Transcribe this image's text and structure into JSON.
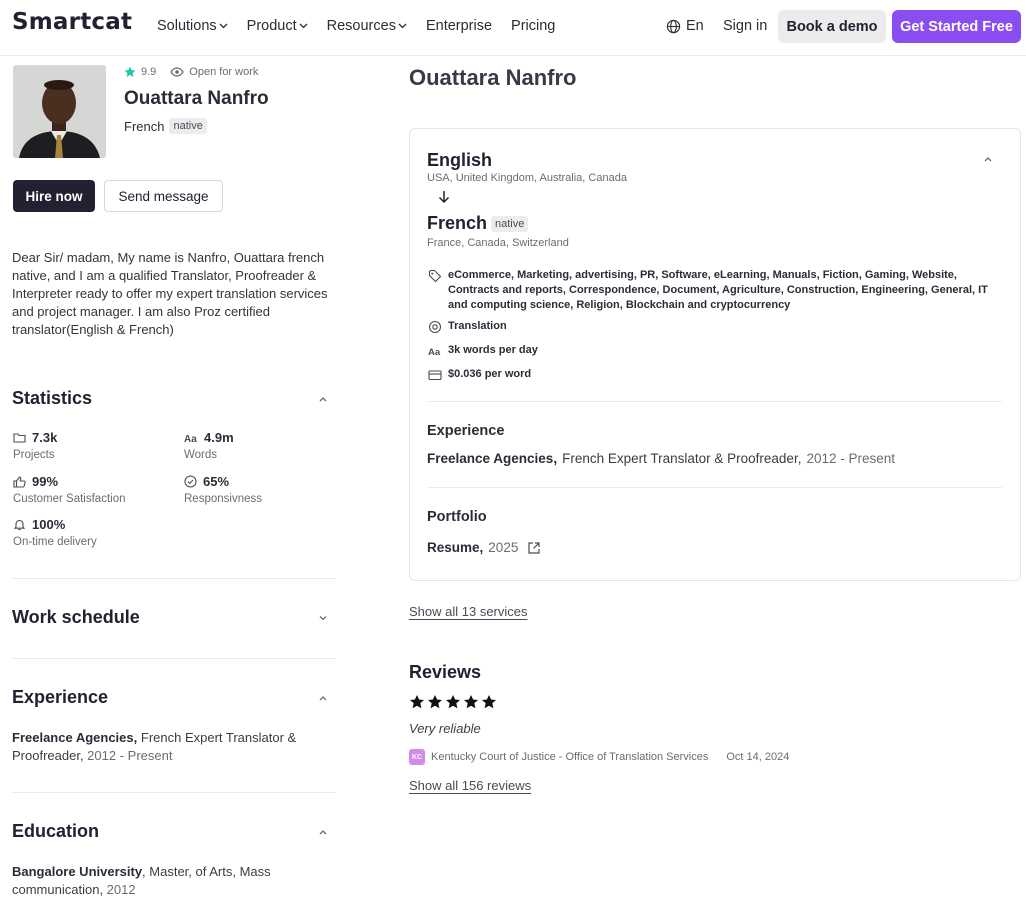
{
  "header": {
    "logo": "Smartcat",
    "nav": [
      "Solutions",
      "Product",
      "Resources",
      "Enterprise",
      "Pricing"
    ],
    "lang": "En",
    "signin": "Sign in",
    "demo": "Book a demo",
    "start": "Get Started Free"
  },
  "profile": {
    "rating": "9.9",
    "status": "Open for work",
    "name": "Ouattara Nanfro",
    "native_lang": "French",
    "native_badge": "native",
    "hire": "Hire now",
    "message": "Send message",
    "bio": "Dear Sir/ madam, My name is Nanfro, Ouattara french native, and I am a qualified Translator, Proofreader & Interpreter ready to offer my expert translation services and project manager. I am also Proz certified translator(English & French)"
  },
  "statistics": {
    "title": "Statistics",
    "items": [
      {
        "value": "7.3k",
        "label": "Projects",
        "icon": "folder-icon"
      },
      {
        "value": "4.9m",
        "label": "Words",
        "icon": "text-size-icon"
      },
      {
        "value": "99%",
        "label": "Customer Satisfaction",
        "icon": "thumbs-up-icon"
      },
      {
        "value": "65%",
        "label": "Responsivness",
        "icon": "check-circle-icon"
      },
      {
        "value": "100%",
        "label": "On-time delivery",
        "icon": "bell-icon"
      }
    ]
  },
  "work_schedule": {
    "title": "Work schedule"
  },
  "experience_left": {
    "title": "Experience",
    "company": "Freelance Agencies",
    "role": "French Expert Translator & Proofreader",
    "period": "2012 - Present"
  },
  "education": {
    "title": "Education",
    "school": "Bangalore University",
    "degree": "Master, of Arts, Mass communication",
    "year": "2012"
  },
  "service": {
    "source_lang": "English",
    "source_countries": "USA, United Kingdom, Australia, Canada",
    "target_lang": "French",
    "target_badge": "native",
    "target_countries": "France, Canada, Switzerland",
    "specializations": "eCommerce, Marketing, advertising, PR, Software, eLearning, Manuals, Fiction, Gaming, Website, Contracts and reports, Correspondence, Document, Agriculture, Construction, Engineering, General, IT and computing science, Religion, Blockchain and cryptocurrency",
    "service_type": "Translation",
    "capacity": "3k words per day",
    "rate": "$0.036 per word",
    "experience_title": "Experience",
    "exp_company": "Freelance Agencies",
    "exp_role": "French Expert Translator & Proofreader",
    "exp_period": "2012 - Present",
    "portfolio_title": "Portfolio",
    "portfolio_item": "Resume",
    "portfolio_year": "2025"
  },
  "show_services": "Show all 13 services",
  "reviews": {
    "title": "Reviews",
    "stars": 5,
    "text": "Very reliable",
    "reviewer_initials": "KC",
    "reviewer": "Kentucky Court of Justice - Office of Translation Services",
    "date": "Oct 14, 2024",
    "show_all": "Show all 156 reviews"
  }
}
